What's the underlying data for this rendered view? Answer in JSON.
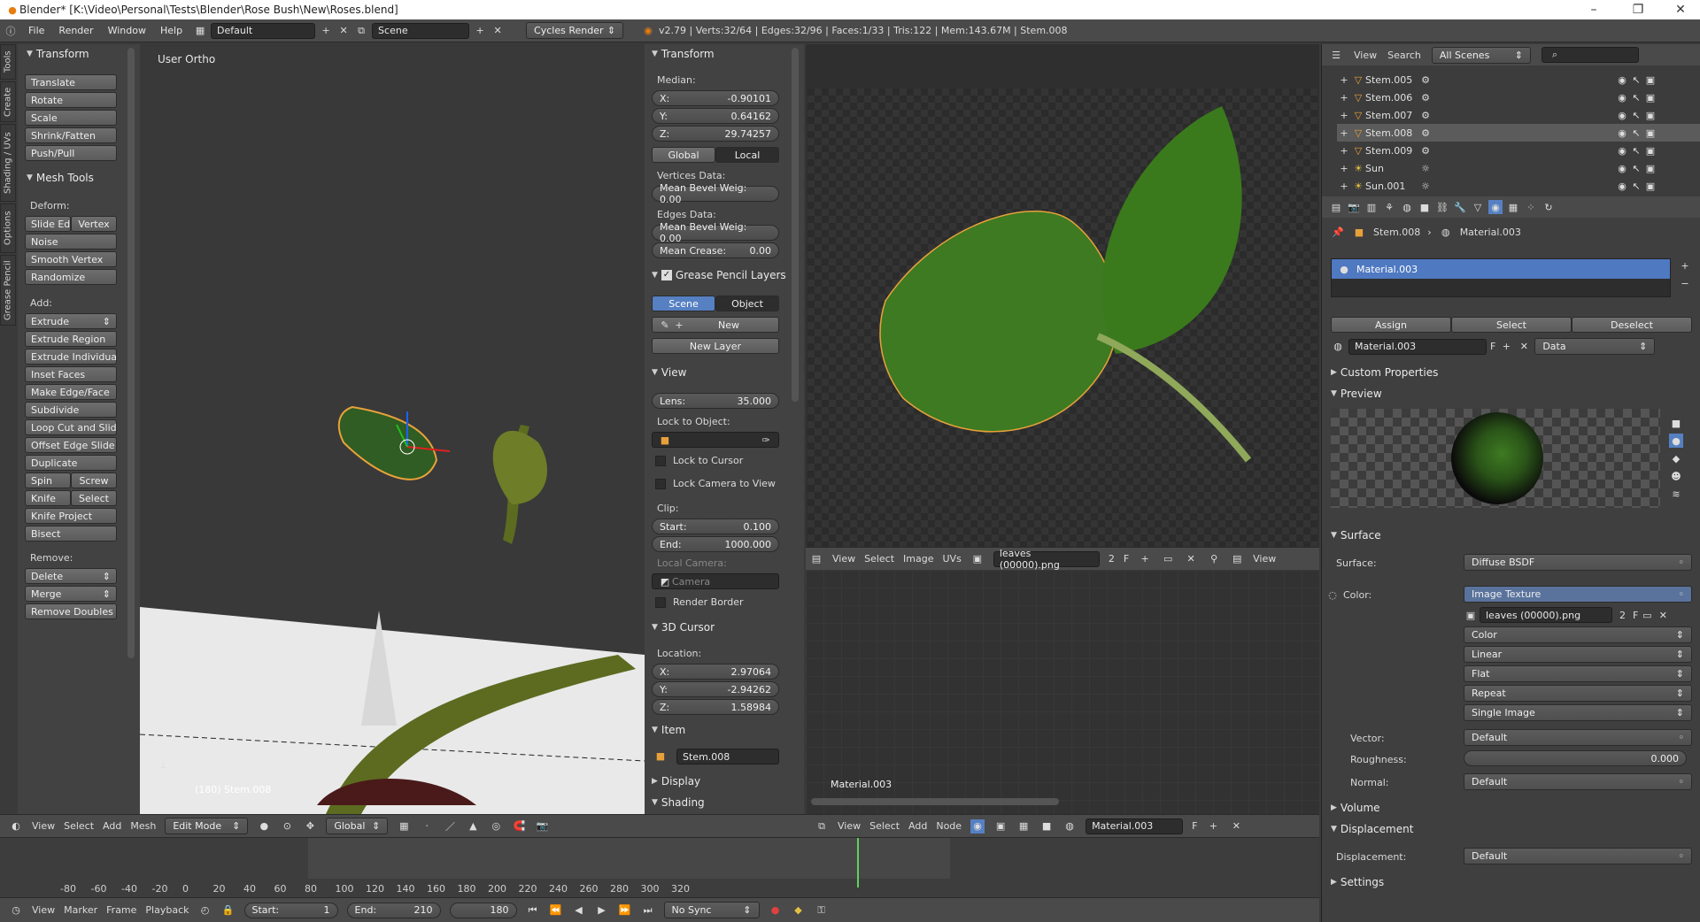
{
  "title_bar": {
    "text": "Blender* [K:\\Video\\Personal\\Tests\\Blender\\Rose Bush\\New\\Roses.blend]"
  },
  "top": {
    "menus": [
      "File",
      "Render",
      "Window",
      "Help"
    ],
    "layout": "Default",
    "scene": "Scene",
    "engine": "Cycles Render",
    "stats": "v2.79 | Verts:32/64 | Edges:32/96 | Faces:1/33 | Tris:122 | Mem:143.67M | Stem.008"
  },
  "tools": {
    "tabs": [
      "Tools",
      "Create",
      "Shading / UVs",
      "Options",
      "Grease Pencil"
    ],
    "transform": {
      "header": "Transform",
      "buttons": [
        "Translate",
        "Rotate",
        "Scale",
        "Shrink/Fatten",
        "Push/Pull"
      ]
    },
    "mesh_tools": {
      "header": "Mesh Tools",
      "deform_label": "Deform:",
      "slide_edge": "Slide Ed",
      "vertex": "Vertex",
      "deform": [
        "Noise",
        "Smooth Vertex",
        "Randomize"
      ],
      "add_label": "Add:",
      "extrude": "Extrude",
      "add": [
        "Extrude Region",
        "Extrude Individual",
        "Inset Faces",
        "Make Edge/Face",
        "Subdivide",
        "Loop Cut and Slide",
        "Offset Edge Slide",
        "Duplicate"
      ],
      "spin": "Spin",
      "screw": "Screw",
      "knife": "Knife",
      "select": "Select",
      "knife_project": "Knife Project",
      "bisect": "Bisect",
      "remove_label": "Remove:",
      "delete": "Delete",
      "merge": "Merge",
      "remove_doubles": "Remove Doubles"
    }
  },
  "viewport": {
    "label": "User Ortho",
    "object_label": "(180) Stem.008"
  },
  "n_panel": {
    "transform_header": "Transform",
    "median": "Median:",
    "x_label": "X:",
    "x": "-0.90101",
    "y_label": "Y:",
    "y": "0.64162",
    "z_label": "Z:",
    "z": "29.74257",
    "global": "Global",
    "local": "Local",
    "vertices_data": "Vertices Data:",
    "mean_bevel_v": "Mean Bevel Weig: 0.00",
    "edges_data": "Edges Data:",
    "mean_bevel_e": "Mean Bevel Weig: 0.00",
    "mean_crease_label": "Mean Crease:",
    "mean_crease": "0.00",
    "gp_header": "Grease Pencil Layers",
    "scene": "Scene",
    "object": "Object",
    "new": "New",
    "new_layer": "New Layer",
    "view_header": "View",
    "lens_label": "Lens:",
    "lens": "35.000",
    "lock_to_object": "Lock to Object:",
    "lock_cursor": "Lock to Cursor",
    "lock_camera": "Lock Camera to View",
    "clip": "Clip:",
    "start_label": "Start:",
    "start": "0.100",
    "end_label": "End:",
    "end": "1000.000",
    "local_camera": "Local Camera:",
    "camera": "Camera",
    "render_border": "Render Border",
    "cursor_header": "3D Cursor",
    "location": "Location:",
    "cx_label": "X:",
    "cx": "2.97064",
    "cy_label": "Y:",
    "cy": "-2.94262",
    "cz_label": "Z:",
    "cz": "1.58984",
    "item_header": "Item",
    "item_name": "Stem.008",
    "display_header": "Display",
    "shading_header": "Shading"
  },
  "uv_header": {
    "menus": [
      "View",
      "Select",
      "Image",
      "UVs"
    ],
    "image": "leaves (00000).png",
    "users": "2",
    "f": "F",
    "view": "View"
  },
  "node_editor": {
    "material_label": "Material.003"
  },
  "node_header": {
    "menus": [
      "View",
      "Select",
      "Add",
      "Node"
    ],
    "material": "Material.003",
    "f": "F"
  },
  "view3d_header": {
    "menus": [
      "View",
      "Select",
      "Add",
      "Mesh"
    ],
    "mode": "Edit Mode",
    "orientation": "Global"
  },
  "timeline": {
    "ticks": [
      "-80",
      "-60",
      "-40",
      "-20",
      "0",
      "20",
      "40",
      "60",
      "80",
      "100",
      "120",
      "140",
      "160",
      "180",
      "200",
      "220",
      "240",
      "260",
      "280",
      "300",
      "320"
    ],
    "menus": [
      "View",
      "Marker",
      "Frame",
      "Playback"
    ],
    "start_label": "Start:",
    "start": "1",
    "end_label": "End:",
    "end": "210",
    "current": "180",
    "sync": "No Sync"
  },
  "outliner": {
    "menus": [
      "View",
      "Search"
    ],
    "scenes": "All Scenes",
    "items": [
      "Stem.005",
      "Stem.006",
      "Stem.007",
      "Stem.008",
      "Stem.009",
      "Sun",
      "Sun.001"
    ]
  },
  "properties": {
    "breadcrumb_object": "Stem.008",
    "breadcrumb_material": "Material.003",
    "slot": "Material.003",
    "assign": "Assign",
    "select": "Select",
    "deselect": "Deselect",
    "material_name": "Material.003",
    "f": "F",
    "data": "Data",
    "custom_props": "Custom Properties",
    "preview": "Preview",
    "surface_header": "Surface",
    "surface_label": "Surface:",
    "surface": "Diffuse BSDF",
    "color_label": "Color:",
    "color_value": "Image Texture",
    "image": "leaves (00000).png",
    "users": "2",
    "tex_opts": [
      "Color",
      "Linear",
      "Flat",
      "Repeat",
      "Single Image"
    ],
    "vector_label": "Vector:",
    "vector": "Default",
    "roughness_label": "Roughness:",
    "roughness": "0.000",
    "normal_label": "Normal:",
    "normal": "Default",
    "volume": "Volume",
    "displacement_header": "Displacement",
    "displacement_label": "Displacement:",
    "displacement": "Default",
    "settings": "Settings"
  },
  "colors": {
    "accent": "#5680c2",
    "leaf": "#3f7f2a",
    "stem": "#6b7a2a"
  }
}
